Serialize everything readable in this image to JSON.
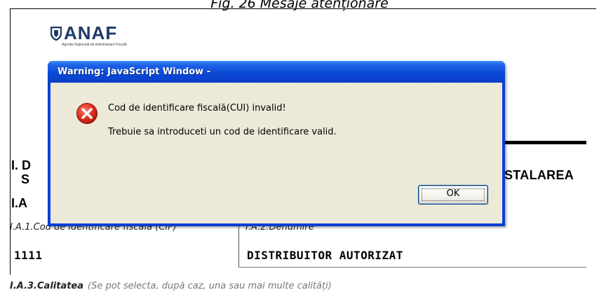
{
  "caption": "Fig. 26 Mesaje atenționare",
  "logo": {
    "mark": "ANAF",
    "subtitle": "Agenția Națională de Administrare Fiscală"
  },
  "document": {
    "section_i": "I. D",
    "section_s": "S",
    "section_ia": "I.A",
    "heading_tail": "STALAREA",
    "field_cif_label": "I.A.1.Cod de identificare fiscală (CIF)",
    "field_cif_value": "1111",
    "field_den_label": "I.A.2.Denumire",
    "field_den_value": "DISTRIBUITOR AUTORIZAT",
    "calitatea_label": "I.A.3.Calitatea",
    "calitatea_hint": "(Se pot selecta, după caz, una sau mai multe calități)"
  },
  "dialog": {
    "title": "Warning: JavaScript Window -",
    "icon": "error-icon",
    "message_1": "Cod de identificare fiscală(CUI) invalid!",
    "message_2": "Trebuie sa introduceti un cod de identificare valid.",
    "ok_label": "OK"
  },
  "colors": {
    "title_bar": "#0a48d6",
    "dialog_bg": "#ece9d8",
    "error_red": "#d42a1f",
    "logo_blue": "#1f3a68"
  }
}
